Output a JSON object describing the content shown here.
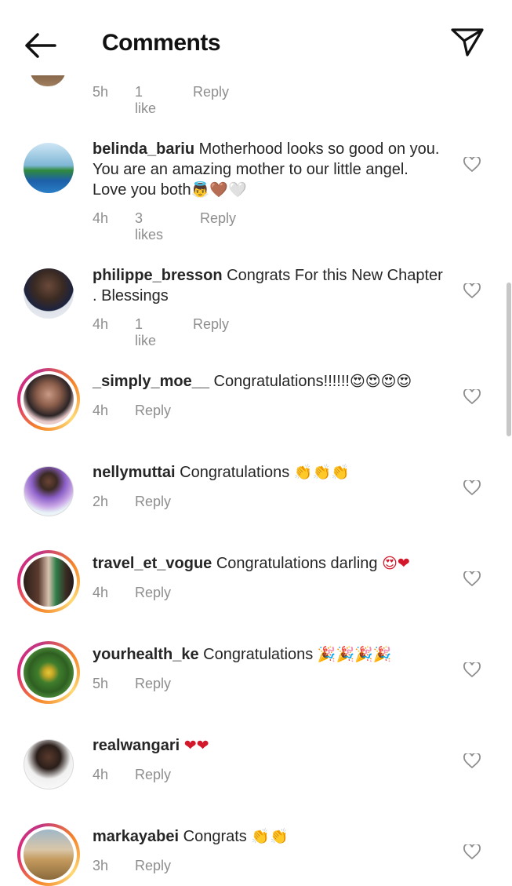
{
  "header": {
    "title": "Comments",
    "back_icon": "arrow-left-icon",
    "share_icon": "paper-plane-icon"
  },
  "previous_comment": {
    "time": "5h",
    "likes": "1 like",
    "reply": "Reply"
  },
  "comments": [
    {
      "username": "belinda_bariu",
      "text": "Motherhood looks so good on you. You are an amazing mother to our little angel. Love you both",
      "emoji": "👼🤎🤍",
      "time": "4h",
      "likes": "3 likes",
      "reply": "Reply"
    },
    {
      "username": "philippe_bresson",
      "text": "Congrats For this New Chapter . Blessings",
      "emoji": "",
      "time": "4h",
      "likes": "1 like",
      "reply": "Reply"
    },
    {
      "username": "_simply_moe__",
      "text": "Congratulations!!!!!!",
      "emoji": "😍😍😍😍",
      "time": "4h",
      "likes": "",
      "reply": "Reply"
    },
    {
      "username": "nellymuttai",
      "text": "Congratulations ",
      "emoji": "👏👏👏",
      "time": "2h",
      "likes": "",
      "reply": "Reply"
    },
    {
      "username": "travel_et_vogue",
      "text": "Congratulations darling ",
      "emoji": "😍❤",
      "time": "4h",
      "likes": "",
      "reply": "Reply"
    },
    {
      "username": "yourhealth_ke",
      "text": "Congratulations ",
      "emoji": "🎉🎉🎉🎉",
      "time": "5h",
      "likes": "",
      "reply": "Reply"
    },
    {
      "username": "realwangari",
      "text": "",
      "emoji": "❤❤",
      "time": "4h",
      "likes": "",
      "reply": "Reply"
    },
    {
      "username": "markayabei",
      "text": "Congrats ",
      "emoji": "👏👏",
      "time": "3h",
      "likes": "",
      "reply": "Reply"
    }
  ],
  "colors": {
    "text": "#262626",
    "meta": "#8e8e8e",
    "story_ring_start": "#f58529",
    "story_ring_end": "#dd2a7b"
  }
}
